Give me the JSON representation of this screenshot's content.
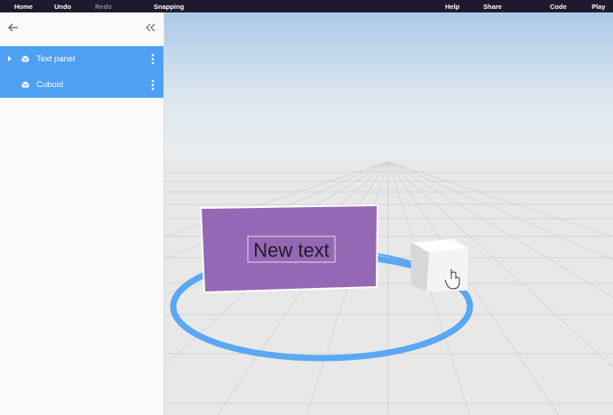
{
  "topbar": {
    "home": "Home",
    "undo": "Undo",
    "redo": "Redo",
    "snapping": "Snapping",
    "help": "Help",
    "share": "Share",
    "code": "Code",
    "play": "Play"
  },
  "sidebar": {
    "items": [
      {
        "label": "Text panel",
        "icon": "cube-icon",
        "expandable": true
      },
      {
        "label": "Cuboid",
        "icon": "cube-icon",
        "expandable": false
      }
    ]
  },
  "scene": {
    "text_panel": {
      "text": "New text",
      "color": "#9568b5"
    },
    "cuboid": {
      "color": "#f4f4f4"
    },
    "selection_ring_color": "#5aa8f2"
  },
  "colors": {
    "topbar_bg": "#1e1a2e",
    "selected_item": "#4ea0f5"
  }
}
